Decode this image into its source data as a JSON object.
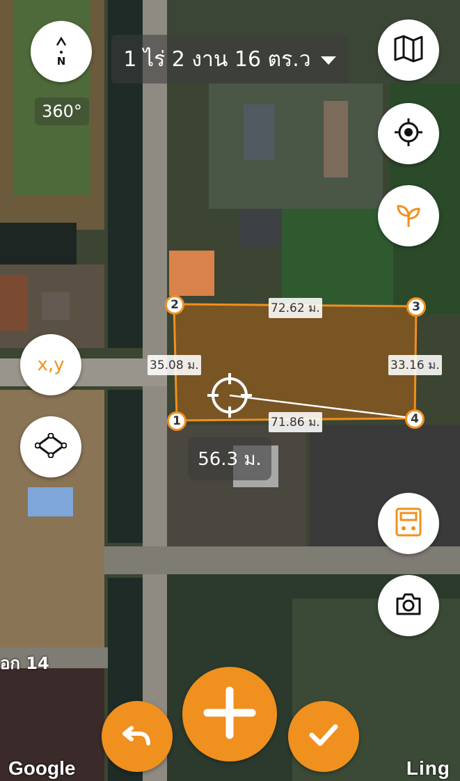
{
  "area": {
    "label": "1 ไร่ 2 งาน 16 ตร.ว"
  },
  "compass": {
    "letter": "N"
  },
  "heading": {
    "text": "360°"
  },
  "edges": {
    "top": "72.62 ม.",
    "left": "35.08 ม.",
    "right": "33.16 ม.",
    "bottom": "71.86 ม."
  },
  "vertices": [
    "1",
    "2",
    "3",
    "4"
  ],
  "distance": {
    "text": "56.3 ม."
  },
  "coord_button": {
    "label": "x,y"
  },
  "road_label": "อก 14",
  "attribution": {
    "google": "Google",
    "brand": "Ling"
  },
  "icons": {
    "map": "map-icon",
    "locate": "crosshair-icon",
    "plant": "sprout-icon",
    "polygon": "polygon-icon",
    "calculator": "calculator-icon",
    "camera": "camera-icon",
    "undo": "undo-icon",
    "add": "plus-icon",
    "confirm": "check-icon"
  },
  "colors": {
    "accent": "#f0901e",
    "polygon_fill": "#8a5a20"
  }
}
